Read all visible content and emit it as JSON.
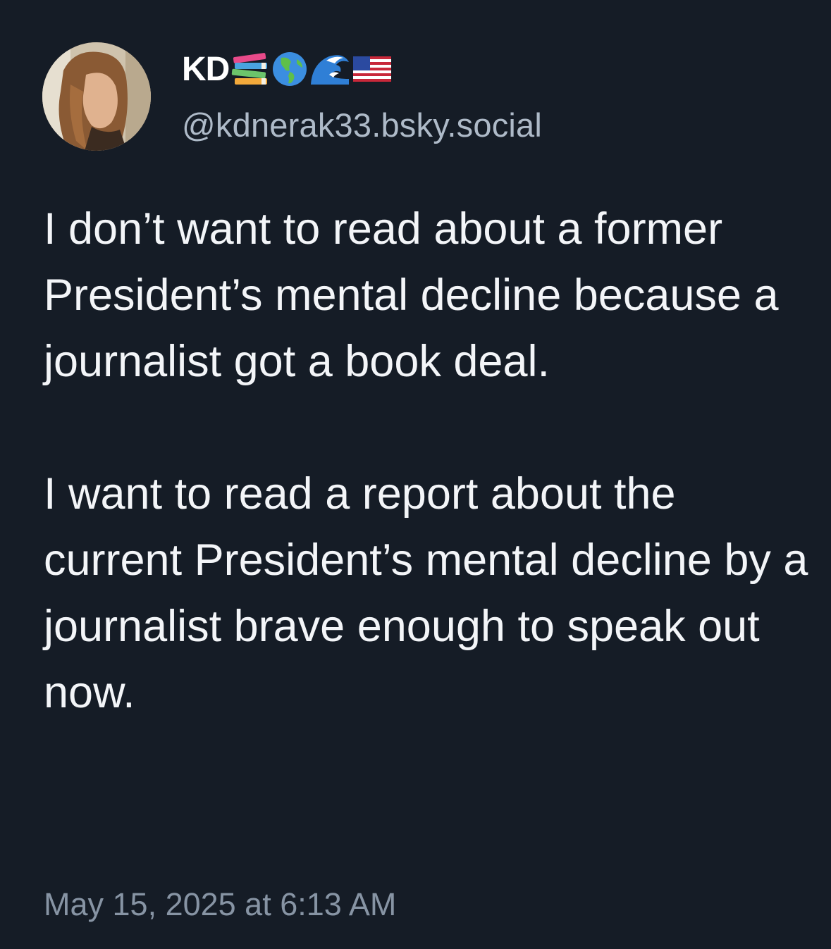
{
  "post": {
    "author": {
      "display_name": "KD",
      "name_emojis": [
        "books-emoji",
        "globe-americas-emoji",
        "water-wave-emoji",
        "us-flag-emoji"
      ],
      "handle": "@kdnerak33.bsky.social"
    },
    "body": {
      "paragraph_1": "I don’t want to read about a former President’s mental decline because a journalist got a book deal.",
      "paragraph_2": "I want to read a report about the current President’s mental decline by a journalist brave enough to speak out now."
    },
    "timestamp": "May 15, 2025 at 6:13 AM"
  },
  "colors": {
    "background": "#151c26",
    "text": "#f3f5f8",
    "handle": "#aebac8",
    "timestamp": "#8794a4"
  }
}
